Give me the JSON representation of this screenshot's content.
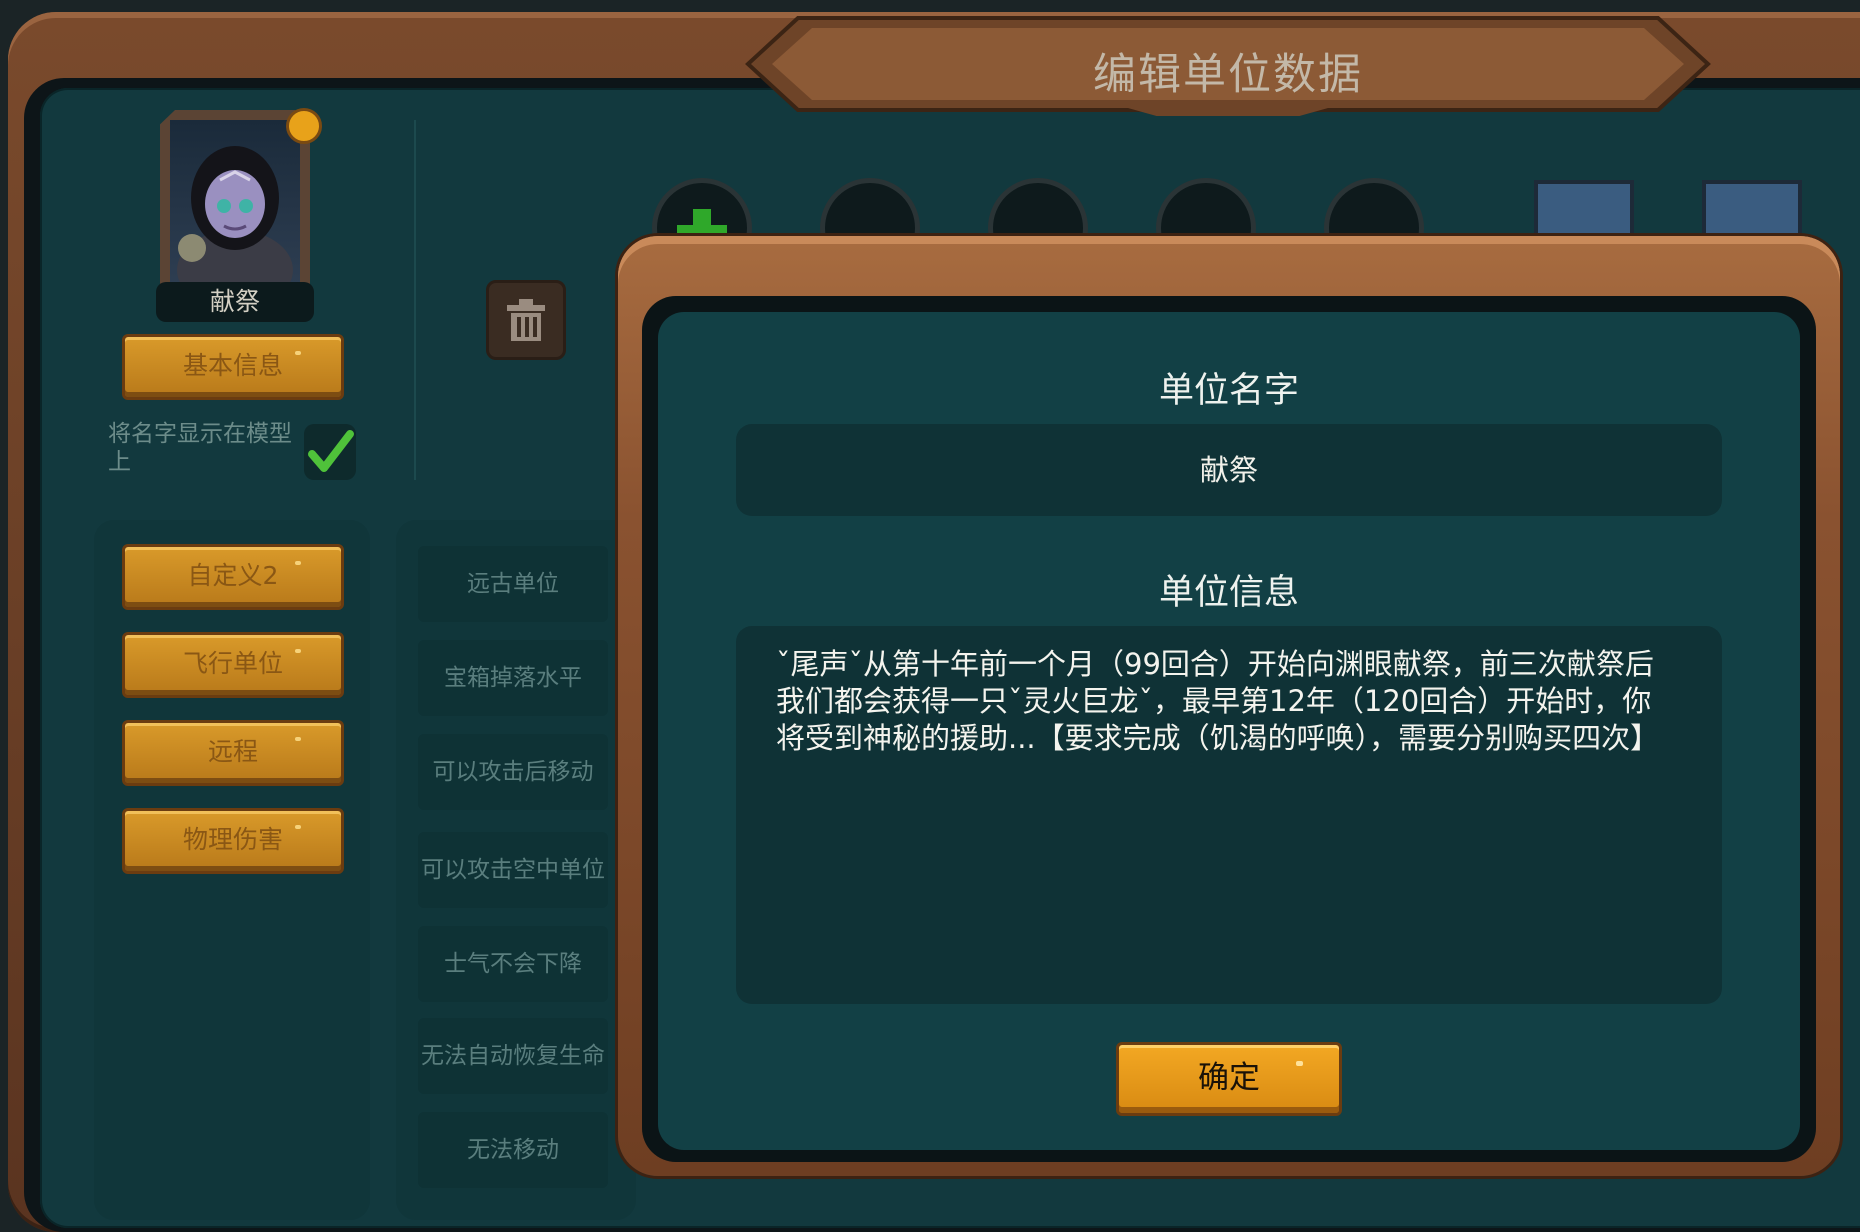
{
  "window": {
    "title": "编辑单位数据"
  },
  "unit": {
    "portrait_name": "献祭",
    "basic_info_button": "基本信息",
    "show_name_label": "将名字显示在模型上",
    "show_name_checked": true
  },
  "tags": [
    "自定义2",
    "飞行单位",
    "远程",
    "物理伤害"
  ],
  "attributes": [
    "远古单位",
    "宝箱掉落水平",
    "可以攻击后移动",
    "可以攻击空中单位",
    "士气不会下降",
    "无法自动恢复生命",
    "无法移动"
  ],
  "dialog": {
    "name_label": "单位名字",
    "name_value": "献祭",
    "info_label": "单位信息",
    "info_value": "ˇ尾声ˇ从第十年前一个月（99回合）开始向渊眼献祭，前三次献祭后我们都会获得一只ˇ灵火巨龙ˇ，最早第12年（120回合）开始时，你将受到神秘的援助...【要求完成（饥渴的呼唤），需要分别购买四次】",
    "confirm_button": "确定"
  },
  "colors": {
    "wood": "#8a5230",
    "panel": "#124045",
    "gold_button": "#d99a2a",
    "check": "#4fc23a"
  },
  "icons": {
    "trash": "trash-icon",
    "check": "check-icon",
    "add": "plus-icon",
    "badge": "badge-icon"
  }
}
